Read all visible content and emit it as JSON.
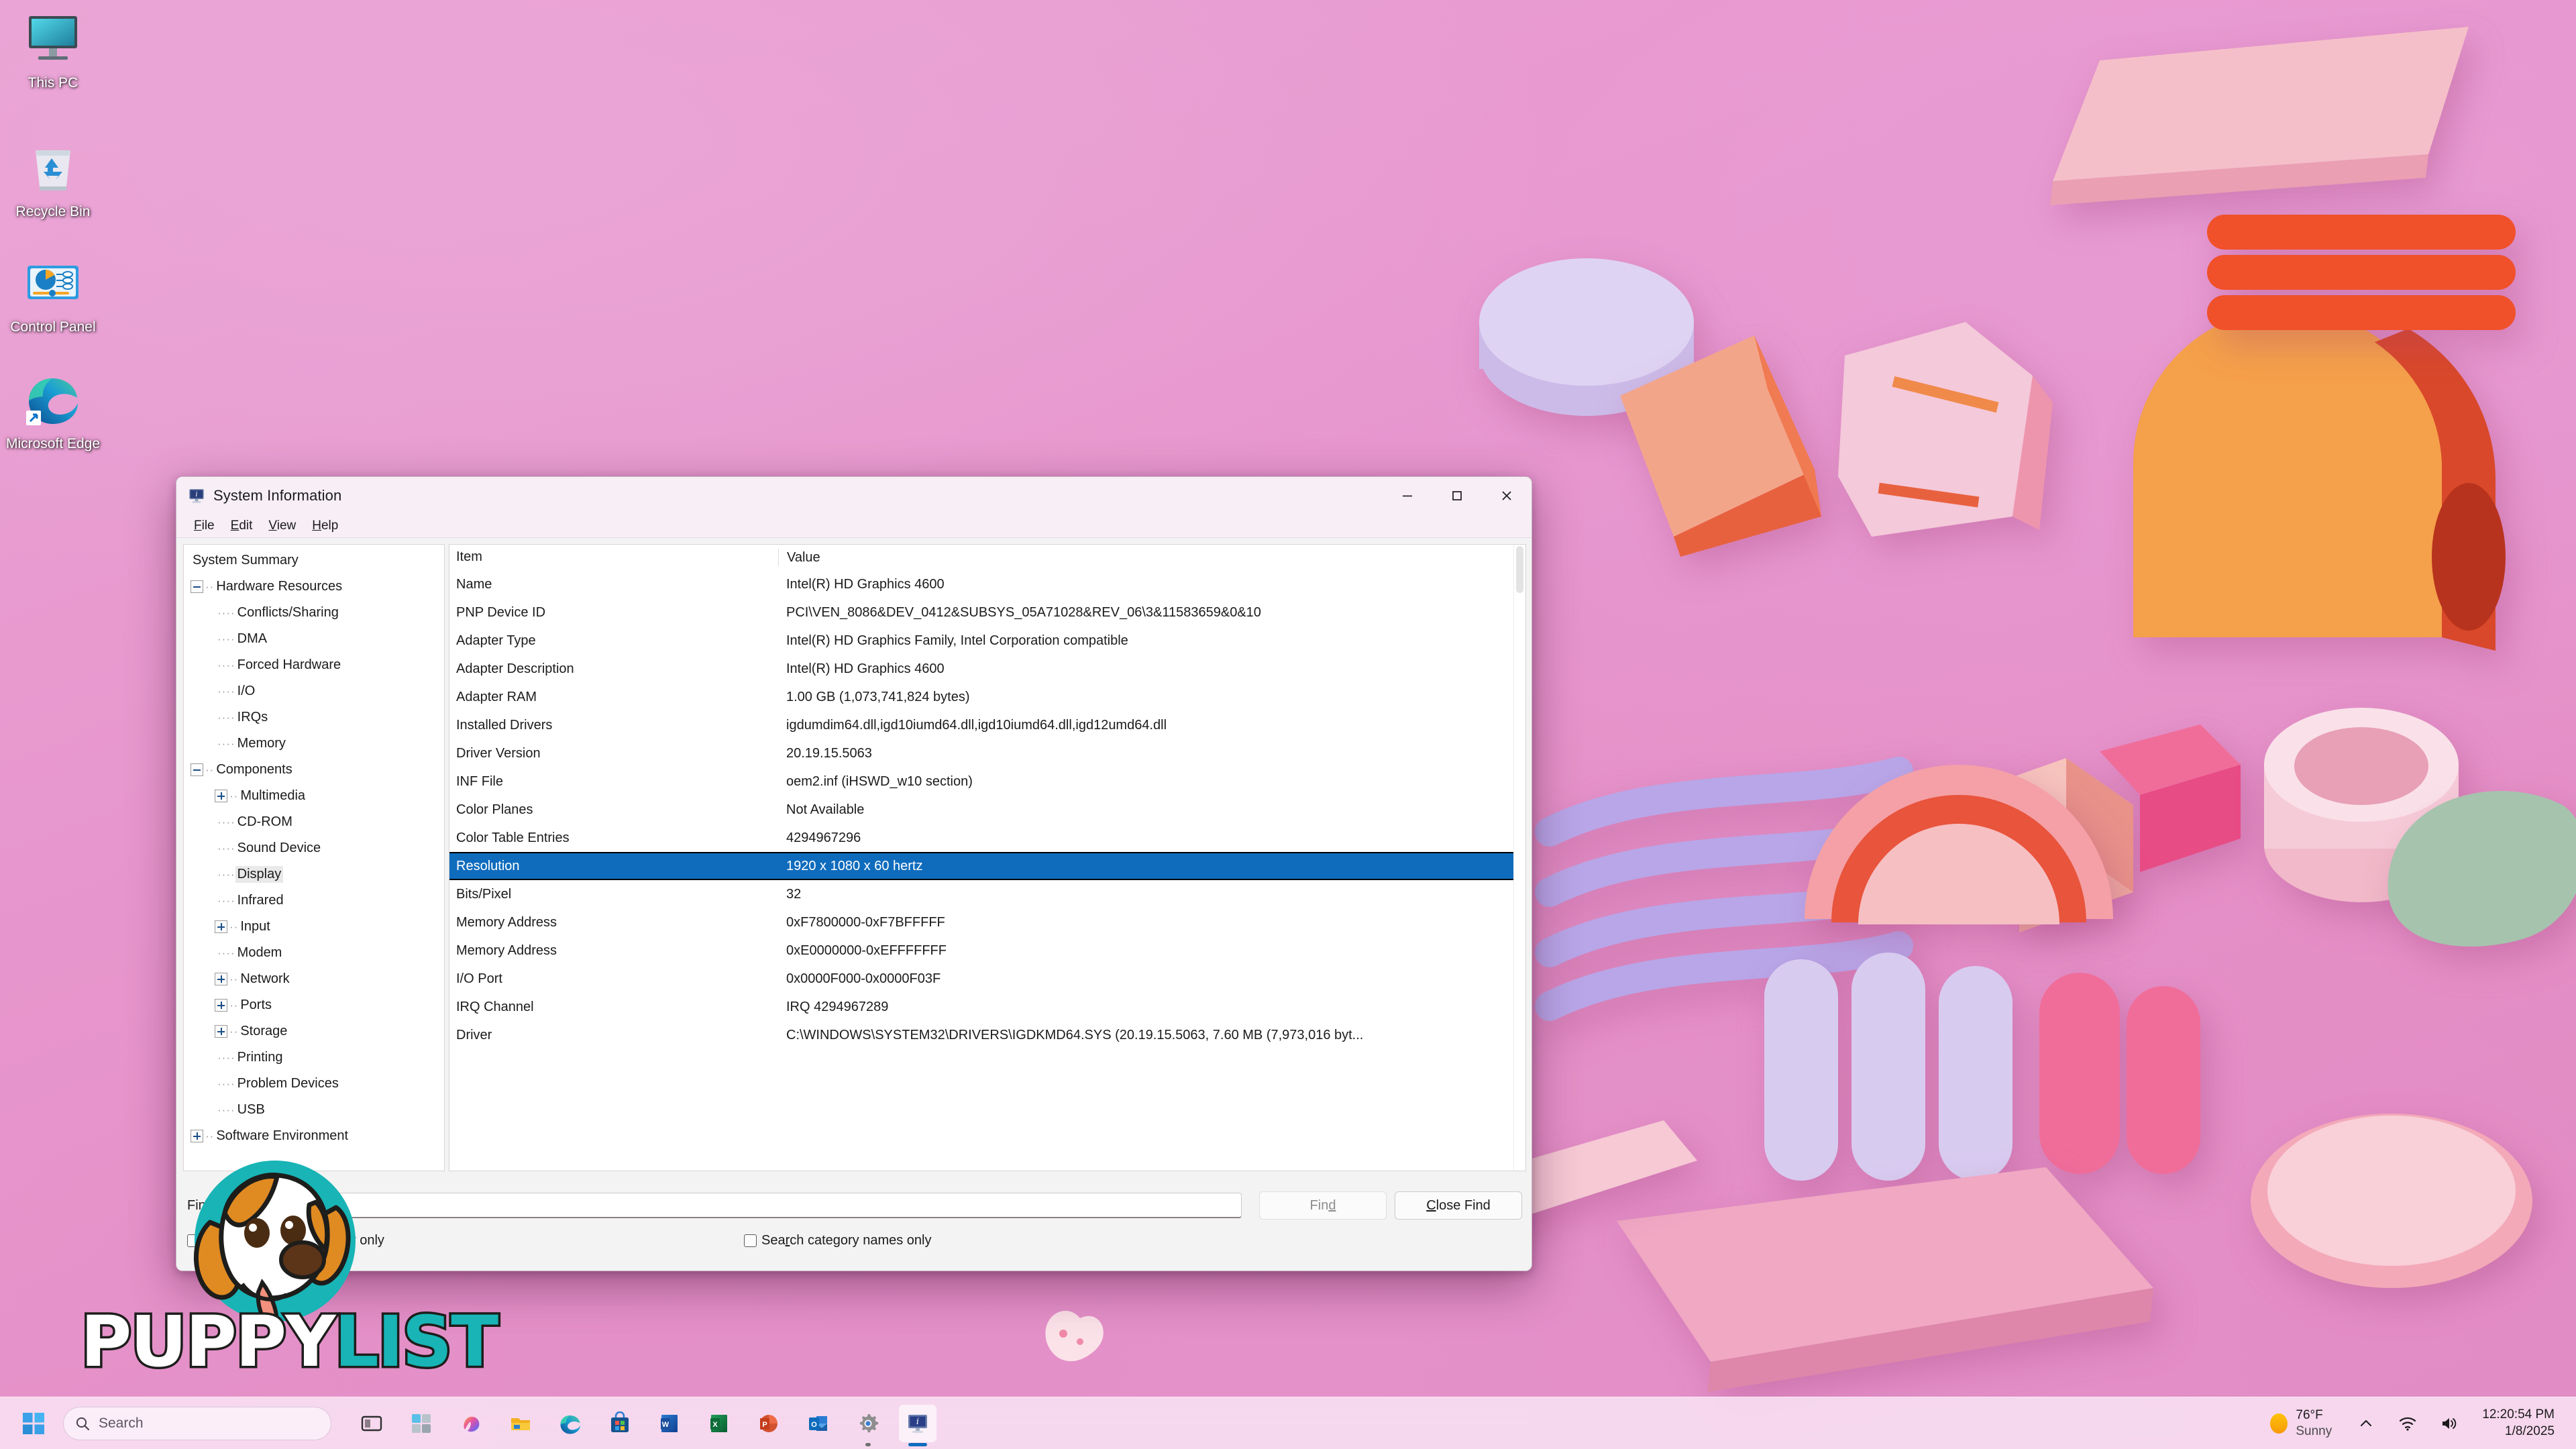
{
  "desktop": {
    "icons": [
      {
        "label": "This PC",
        "icon": "this-pc-icon"
      },
      {
        "label": "Recycle Bin",
        "icon": "recycle-bin-icon"
      },
      {
        "label": "Control Panel",
        "icon": "control-panel-icon"
      },
      {
        "label": "Microsoft Edge",
        "icon": "microsoft-edge-icon"
      }
    ]
  },
  "window": {
    "title": "System Information",
    "icon": "system-information-icon",
    "controls": {
      "minimize": "minimize-icon",
      "maximize": "maximize-icon",
      "close": "close-icon"
    },
    "menu": [
      {
        "label": "File",
        "accel": "F"
      },
      {
        "label": "Edit",
        "accel": "E"
      },
      {
        "label": "View",
        "accel": "V"
      },
      {
        "label": "Help",
        "accel": "H"
      }
    ],
    "tree": [
      {
        "label": "System Summary",
        "depth": 0,
        "expander": "none",
        "selected": false
      },
      {
        "label": "Hardware Resources",
        "depth": 0,
        "expander": "minus",
        "selected": false
      },
      {
        "label": "Conflicts/Sharing",
        "depth": 1,
        "expander": "leaf",
        "selected": false
      },
      {
        "label": "DMA",
        "depth": 1,
        "expander": "leaf",
        "selected": false
      },
      {
        "label": "Forced Hardware",
        "depth": 1,
        "expander": "leaf",
        "selected": false
      },
      {
        "label": "I/O",
        "depth": 1,
        "expander": "leaf",
        "selected": false
      },
      {
        "label": "IRQs",
        "depth": 1,
        "expander": "leaf",
        "selected": false
      },
      {
        "label": "Memory",
        "depth": 1,
        "expander": "leaf",
        "selected": false
      },
      {
        "label": "Components",
        "depth": 0,
        "expander": "minus",
        "selected": false
      },
      {
        "label": "Multimedia",
        "depth": 1,
        "expander": "plus",
        "selected": false
      },
      {
        "label": "CD-ROM",
        "depth": 1,
        "expander": "leaf",
        "selected": false
      },
      {
        "label": "Sound Device",
        "depth": 1,
        "expander": "leaf",
        "selected": false
      },
      {
        "label": "Display",
        "depth": 1,
        "expander": "leaf",
        "selected": true
      },
      {
        "label": "Infrared",
        "depth": 1,
        "expander": "leaf",
        "selected": false
      },
      {
        "label": "Input",
        "depth": 1,
        "expander": "plus",
        "selected": false
      },
      {
        "label": "Modem",
        "depth": 1,
        "expander": "leaf",
        "selected": false
      },
      {
        "label": "Network",
        "depth": 1,
        "expander": "plus",
        "selected": false
      },
      {
        "label": "Ports",
        "depth": 1,
        "expander": "plus",
        "selected": false
      },
      {
        "label": "Storage",
        "depth": 1,
        "expander": "plus",
        "selected": false
      },
      {
        "label": "Printing",
        "depth": 1,
        "expander": "leaf",
        "selected": false
      },
      {
        "label": "Problem Devices",
        "depth": 1,
        "expander": "leaf",
        "selected": false
      },
      {
        "label": "USB",
        "depth": 1,
        "expander": "leaf",
        "selected": false
      },
      {
        "label": "Software Environment",
        "depth": 0,
        "expander": "plus",
        "selected": false
      }
    ],
    "table": {
      "columns": [
        "Item",
        "Value"
      ],
      "rows": [
        {
          "item": "Name",
          "value": "Intel(R) HD Graphics 4600",
          "selected": false
        },
        {
          "item": "PNP Device ID",
          "value": "PCI\\VEN_8086&DEV_0412&SUBSYS_05A71028&REV_06\\3&11583659&0&10",
          "selected": false
        },
        {
          "item": "Adapter Type",
          "value": "Intel(R) HD Graphics Family, Intel Corporation compatible",
          "selected": false
        },
        {
          "item": "Adapter Description",
          "value": "Intel(R) HD Graphics 4600",
          "selected": false
        },
        {
          "item": "Adapter RAM",
          "value": "1.00 GB (1,073,741,824 bytes)",
          "selected": false
        },
        {
          "item": "Installed Drivers",
          "value": "igdumdim64.dll,igd10iumd64.dll,igd10iumd64.dll,igd12umd64.dll",
          "selected": false
        },
        {
          "item": "Driver Version",
          "value": "20.19.15.5063",
          "selected": false
        },
        {
          "item": "INF File",
          "value": "oem2.inf (iHSWD_w10 section)",
          "selected": false
        },
        {
          "item": "Color Planes",
          "value": "Not Available",
          "selected": false
        },
        {
          "item": "Color Table Entries",
          "value": "4294967296",
          "selected": false
        },
        {
          "item": "Resolution",
          "value": "1920 x 1080 x 60 hertz",
          "selected": true
        },
        {
          "item": "Bits/Pixel",
          "value": "32",
          "selected": false
        },
        {
          "item": "Memory Address",
          "value": "0xF7800000-0xF7BFFFFF",
          "selected": false
        },
        {
          "item": "Memory Address",
          "value": "0xE0000000-0xEFFFFFFF",
          "selected": false
        },
        {
          "item": "I/O Port",
          "value": "0x0000F000-0x0000F03F",
          "selected": false
        },
        {
          "item": "IRQ Channel",
          "value": "IRQ 4294967289",
          "selected": false
        },
        {
          "item": "Driver",
          "value": "C:\\WINDOWS\\SYSTEM32\\DRIVERS\\IGDKMD64.SYS (20.19.15.5063, 7.60 MB (7,973,016 byt...",
          "selected": false
        }
      ]
    },
    "find": {
      "label": "Find what:",
      "short_label": "Find",
      "value": "",
      "placeholder": "",
      "find_button": "Find",
      "find_button_accel": "d",
      "close_button": "Close Find",
      "close_button_accel": "C",
      "selected_category_checkbox": "Search selected category only",
      "selected_category_checked": false,
      "category_names_checkbox": "Search category names only",
      "category_names_accel": "r",
      "category_names_checked": false
    },
    "selection_color": "#0f6cbd"
  },
  "watermark": {
    "brand_part1": "PUPPY",
    "brand_part2": "LIST",
    "mascot": "puppy-mascot-icon",
    "teal": "#18b4b6"
  },
  "taskbar": {
    "start": "windows-start-icon",
    "search_placeholder": "Search",
    "search_icon": "search-icon",
    "apps": [
      {
        "name": "task-view-icon",
        "label": "Task View",
        "active": false
      },
      {
        "name": "widgets-icon",
        "label": "Widgets",
        "active": false
      },
      {
        "name": "copilot-icon",
        "label": "Copilot",
        "active": false
      },
      {
        "name": "file-explorer-icon",
        "label": "File Explorer",
        "active": false
      },
      {
        "name": "microsoft-edge-icon",
        "label": "Microsoft Edge",
        "active": false
      },
      {
        "name": "microsoft-store-icon",
        "label": "Microsoft Store",
        "active": false
      },
      {
        "name": "word-icon",
        "label": "Word",
        "active": false
      },
      {
        "name": "excel-icon",
        "label": "Excel",
        "active": false
      },
      {
        "name": "powerpoint-icon",
        "label": "PowerPoint",
        "active": false
      },
      {
        "name": "outlook-icon",
        "label": "Outlook",
        "active": false
      },
      {
        "name": "settings-icon",
        "label": "Settings",
        "active": false
      },
      {
        "name": "system-information-icon",
        "label": "System Information",
        "active": true
      }
    ],
    "tray": {
      "weather_temp": "76°F",
      "weather_cond": "Sunny",
      "chevron": "chevron-up-icon",
      "network": "wifi-icon",
      "volume": "volume-icon",
      "time": "12:20:54 PM",
      "date": "1/8/2025"
    }
  }
}
